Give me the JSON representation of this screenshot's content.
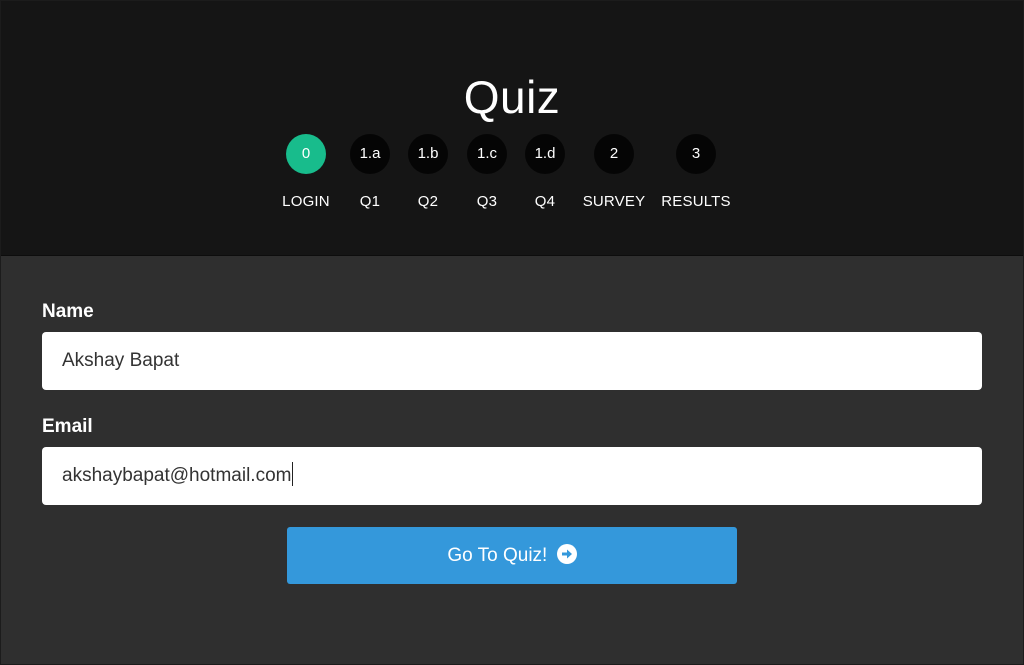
{
  "header": {
    "title": "Quiz",
    "steps": [
      {
        "number": "0",
        "label": "LOGIN",
        "active": true
      },
      {
        "number": "1.a",
        "label": "Q1",
        "active": false
      },
      {
        "number": "1.b",
        "label": "Q2",
        "active": false
      },
      {
        "number": "1.c",
        "label": "Q3",
        "active": false
      },
      {
        "number": "1.d",
        "label": "Q4",
        "active": false
      },
      {
        "number": "2",
        "label": "SURVEY",
        "active": false
      },
      {
        "number": "3",
        "label": "RESULTS",
        "active": false
      }
    ]
  },
  "form": {
    "name_label": "Name",
    "name_value": "Akshay Bapat",
    "email_label": "Email",
    "email_value": "akshaybapat@hotmail.com",
    "submit_label": "Go To Quiz!",
    "submit_icon": "arrow-circle-right-icon"
  },
  "colors": {
    "active_step": "#18bc8c",
    "button": "#3498db",
    "header_bg": "#151515",
    "body_bg": "#2f2f2f"
  }
}
